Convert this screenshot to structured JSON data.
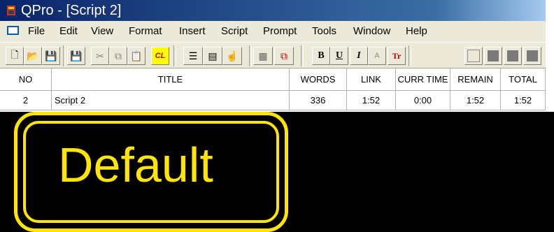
{
  "window": {
    "title": "QPro - [Script 2]"
  },
  "menu": {
    "items": [
      "File",
      "Edit",
      "View",
      "Format",
      "Insert",
      "Script",
      "Prompt",
      "Tools",
      "Window",
      "Help"
    ]
  },
  "toolbar": {
    "buttons": [
      {
        "icon": "new-document-icon",
        "glyph": "🗋"
      },
      {
        "icon": "open-folder-icon",
        "glyph": "📂"
      },
      {
        "icon": "save-icon",
        "glyph": "💾"
      },
      {
        "icon": "save-all-icon",
        "glyph": "💾"
      },
      {
        "icon": "cut-icon",
        "glyph": "✂"
      },
      {
        "icon": "copy-icon",
        "glyph": "⧉"
      },
      {
        "icon": "paste-icon",
        "glyph": "📋"
      },
      {
        "icon": "cl-icon",
        "glyph": "CL"
      },
      {
        "icon": "script-list-icon",
        "glyph": "☰"
      },
      {
        "icon": "prompt-icon",
        "glyph": "▤"
      },
      {
        "icon": "pointer-icon",
        "glyph": "☝"
      },
      {
        "icon": "grid-icon",
        "glyph": "▦"
      },
      {
        "icon": "window-icon",
        "glyph": "⧉"
      },
      {
        "icon": "bold-icon",
        "glyph": "B"
      },
      {
        "icon": "underline-icon",
        "glyph": "U"
      },
      {
        "icon": "italic-icon",
        "glyph": "I"
      },
      {
        "icon": "font-size-icon",
        "glyph": "A"
      },
      {
        "icon": "font-color-icon",
        "glyph": "Tr"
      },
      {
        "icon": "style-1-icon",
        "glyph": ""
      },
      {
        "icon": "style-2-icon",
        "glyph": ""
      },
      {
        "icon": "style-3-icon",
        "glyph": ""
      },
      {
        "icon": "style-4-icon",
        "glyph": ""
      }
    ]
  },
  "table": {
    "headers": [
      "NO",
      "TITLE",
      "WORDS",
      "LINK",
      "CURR TIME",
      "REMAIN",
      "TOTAL"
    ],
    "rows": [
      [
        "2",
        "Script 2",
        "336",
        "1:52",
        "0:00",
        "1:52",
        "1:52"
      ]
    ]
  },
  "prompt": {
    "text": "Default",
    "color": "#ffe500"
  }
}
